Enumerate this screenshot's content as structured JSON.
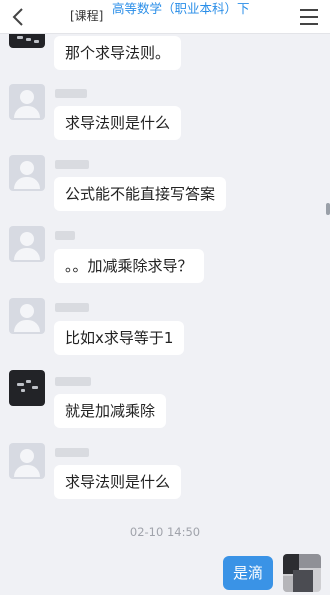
{
  "header": {
    "course_tag": "[课程]",
    "course_name": "高等数学（职业本科）下"
  },
  "messages": [
    {
      "text": "那个求导法则。"
    },
    {
      "text": "求导法则是什么"
    },
    {
      "text": "公式能不能直接写答案"
    },
    {
      "text": "。。加减乘除求导？"
    },
    {
      "text": "比如x求导等于1"
    },
    {
      "text": "就是加减乘除"
    },
    {
      "text": "求导法则是什么"
    }
  ],
  "timestamp": "02-10 14:50",
  "my_message": "是滴",
  "colors": {
    "accent": "#2a8ee8",
    "my_bubble": "#3a93e6",
    "background": "#f0f1f5"
  }
}
